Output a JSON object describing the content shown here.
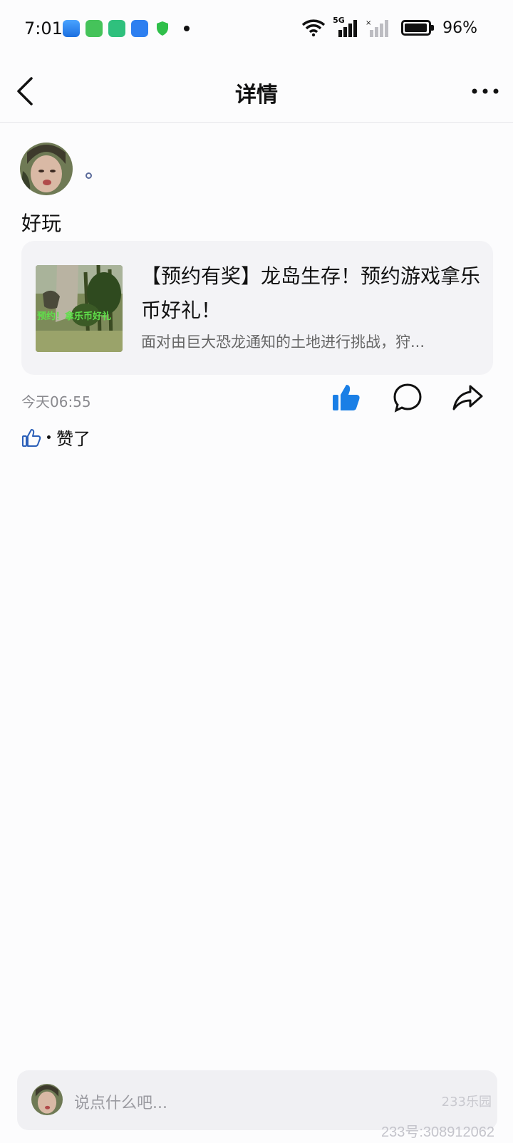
{
  "status_bar": {
    "time": "7:01",
    "network": "5G",
    "battery_text": "96%",
    "battery_level": 0.96,
    "app_icons": [
      "weather-icon",
      "calculator-icon",
      "battery-app-icon",
      "files-icon",
      "shield-icon"
    ]
  },
  "header": {
    "title": "详情",
    "back_icon": "chevron-left-icon",
    "more_icon": "more-dots-icon"
  },
  "post": {
    "author_name": "",
    "text": "好玩",
    "card": {
      "title": "【预约有奖】龙岛生存！预约游戏拿乐币好礼！",
      "description": "面对由巨大恐龙通知的土地进行挑战，狩...",
      "thumbnail_text": "预约！拿乐币好礼"
    },
    "time": "今天06:55",
    "actions": [
      "like-icon",
      "comment-icon",
      "share-icon"
    ],
    "liked": true,
    "liked_text": "赞了"
  },
  "comment_bar": {
    "placeholder": "说点什么吧..."
  },
  "watermark": {
    "logo": "233乐园",
    "id_text": "233号:308912062"
  },
  "colors": {
    "accent": "#1a7fe6",
    "background": "#fcfcfd",
    "card_bg": "#f3f3f6"
  }
}
